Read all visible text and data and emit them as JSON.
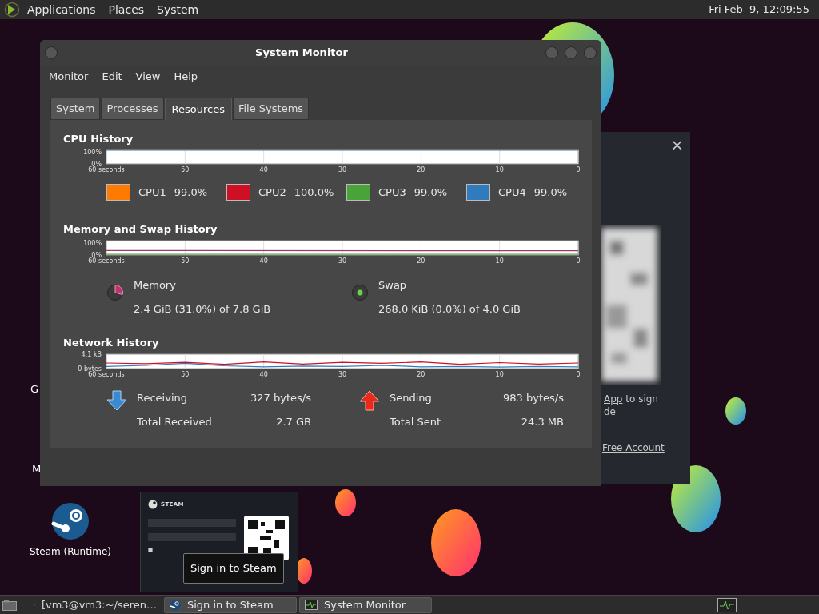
{
  "top_panel": {
    "menus": [
      "Applications",
      "Places",
      "System"
    ],
    "clock": "Fri Feb  9, 12:09:55"
  },
  "desktop_icons": [
    {
      "label": "G",
      "kind": "partial"
    },
    {
      "label": "M",
      "kind": "partial"
    },
    {
      "label": "Steam (Runtime)",
      "kind": "steam"
    }
  ],
  "steam_window": {
    "close": "×",
    "lines": [
      {
        "link": "App",
        "rest": " to sign"
      },
      {
        "rest": "de"
      }
    ],
    "footer_link": "Free Account"
  },
  "window": {
    "title": "System Monitor",
    "menus": [
      "Monitor",
      "Edit",
      "View",
      "Help"
    ],
    "tabs": [
      {
        "label": "System",
        "selected": false
      },
      {
        "label": "Processes",
        "selected": false
      },
      {
        "label": "Resources",
        "selected": true
      },
      {
        "label": "File Systems",
        "selected": false
      }
    ],
    "cpu": {
      "title": "CPU History",
      "graph": {
        "kind": "cpu",
        "y_labels": [
          "100%",
          "0%"
        ],
        "x_labels": [
          "60 seconds",
          "50",
          "40",
          "30",
          "20",
          "10",
          "0"
        ]
      },
      "legend": [
        {
          "label": "CPU1",
          "value": "99.0%",
          "color": "#ff7a00"
        },
        {
          "label": "CPU2",
          "value": "100.0%",
          "color": "#cf1024"
        },
        {
          "label": "CPU3",
          "value": "99.0%",
          "color": "#4aa339"
        },
        {
          "label": "CPU4",
          "value": "99.0%",
          "color": "#2f7bbd"
        }
      ]
    },
    "memory": {
      "title": "Memory and Swap History",
      "graph": {
        "kind": "memory",
        "y_labels": [
          "100%",
          "0%"
        ],
        "x_labels": [
          "60 seconds",
          "50",
          "40",
          "30",
          "20",
          "10",
          "0"
        ]
      },
      "items": [
        {
          "kind": "memory",
          "label": "Memory",
          "value": "2.4 GiB (31.0%) of 7.8 GiB"
        },
        {
          "kind": "swap",
          "label": "Swap",
          "value": "268.0 KiB (0.0%) of 4.0 GiB"
        }
      ]
    },
    "network": {
      "title": "Network History",
      "chart_data": {
        "type": "line",
        "x": [
          60,
          55,
          50,
          45,
          40,
          35,
          30,
          25,
          20,
          15,
          10,
          5,
          0
        ],
        "xlim": [
          60,
          0
        ],
        "ylim": [
          0,
          4.1
        ],
        "grid": true,
        "xticks": [
          {
            "value": 60,
            "label": "60 seconds"
          },
          50,
          40,
          30,
          20,
          10,
          0
        ],
        "yticks": [
          {
            "value": 0,
            "label": "0 bytes"
          },
          {
            "value": 4.1,
            "label": "4.1 kB"
          }
        ],
        "series": [
          {
            "name": "Receiving",
            "color": "#2f7bbd",
            "values": [
              0.6,
              0.9,
              1.5,
              0.8,
              0.5,
              0.7,
              0.6,
              0.9,
              0.5,
              0.6,
              0.4,
              0.6,
              0.5
            ]
          },
          {
            "name": "Sending",
            "color": "#cf1024",
            "values": [
              1.6,
              1.4,
              1.8,
              1.2,
              1.9,
              1.3,
              1.8,
              1.5,
              1.9,
              1.2,
              1.7,
              1.3,
              1.6
            ]
          }
        ]
      },
      "items": [
        {
          "kind": "receiving",
          "value": "327 bytes/s",
          "total_label": "Total Received",
          "total": "2.7 GB"
        },
        {
          "kind": "sending",
          "value": "983 bytes/s",
          "total_label": "Total Sent",
          "total": "24.3 MB"
        }
      ]
    }
  },
  "steam_preview": {
    "brand": "STEAM",
    "remember_checked": true,
    "tooltip": "Sign in to Steam"
  },
  "taskbar": {
    "items": [
      {
        "label": "[vm3@vm3:~/seren…",
        "kind": "terminal",
        "highlighted": false
      },
      {
        "label": "Sign in to Steam",
        "kind": "steam",
        "highlighted": true
      },
      {
        "label": "System Monitor",
        "kind": "monitor",
        "highlighted": true
      }
    ]
  }
}
